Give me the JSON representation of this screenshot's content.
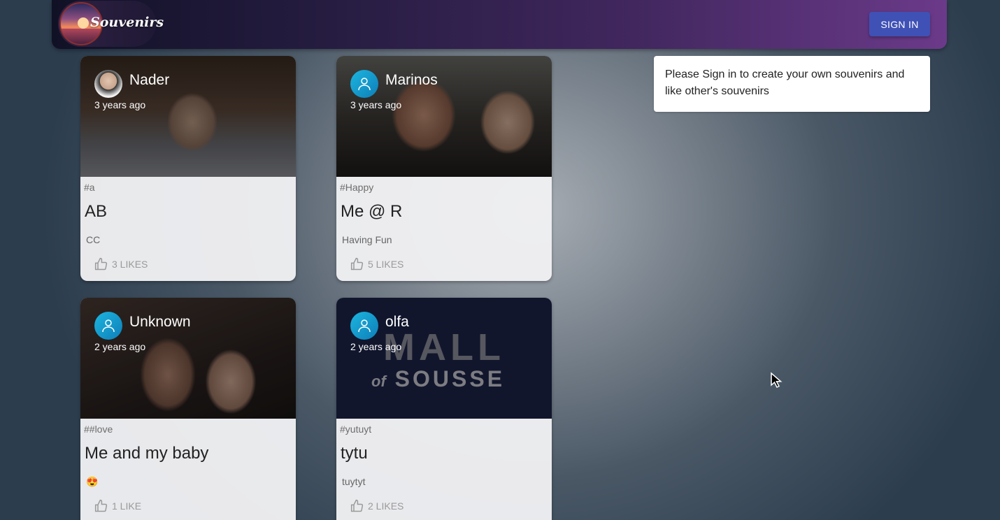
{
  "app": {
    "brand": "Souvenirs",
    "signin_label": "SIGN IN"
  },
  "info": {
    "message": "Please Sign in to create your own souvenirs and like other's souvenirs"
  },
  "posts": [
    {
      "creator": "Nader",
      "time": "3 years ago",
      "tags": "#a",
      "title": "AB",
      "message": "CC",
      "likes": "3 LIKES"
    },
    {
      "creator": "Marinos",
      "time": "3 years ago",
      "tags": "#Happy",
      "title": "Me @ R",
      "message": "Having Fun",
      "likes": "5 LIKES"
    },
    {
      "creator": "Unknown",
      "time": "2 years ago",
      "tags": "##love",
      "title": "Me and my baby",
      "message": "😍",
      "likes": "1 LIKE"
    },
    {
      "creator": "olfa",
      "time": "2 years ago",
      "tags": "#yutuyt",
      "title": "tytu",
      "message": "tuytyt",
      "likes": "2 LIKES"
    }
  ],
  "images": {
    "mall_line1": "MALL",
    "mall_line2": "SOUSSE",
    "mall_prefix": "of"
  },
  "colors": {
    "accent": "#3f51b5",
    "avatar": "#1cb5e0"
  }
}
